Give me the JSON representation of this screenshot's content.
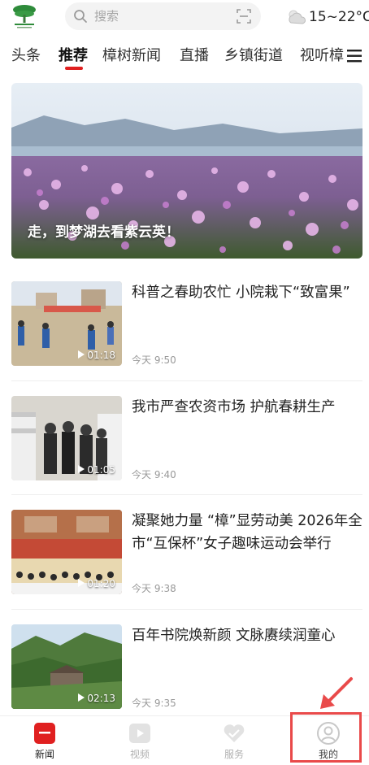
{
  "header": {
    "logo_icon": "zhangshu-logo-icon",
    "search": {
      "placeholder": "搜索",
      "icon": "search-icon",
      "scan_icon": "scan-icon"
    },
    "weather": {
      "icon": "cloud-sun-icon",
      "text": "15~22°C"
    }
  },
  "tabs": {
    "items": [
      {
        "label": "头条"
      },
      {
        "label": "推荐"
      },
      {
        "label": "樟树新闻"
      },
      {
        "label": "直播"
      },
      {
        "label": "乡镇街道"
      },
      {
        "label": "视听樟"
      }
    ],
    "active_index": 1,
    "menu_icon": "menu-icon",
    "accent": "#e02020"
  },
  "hero": {
    "caption": "走，到梦湖去看紫云英！"
  },
  "news": [
    {
      "title": "科普之春助农忙 小院栽下“致富果”",
      "duration": "01:18",
      "time": "今天 9:50"
    },
    {
      "title": "我市严查农资市场 护航春耕生产",
      "duration": "01:05",
      "time": "今天 9:40"
    },
    {
      "title": "凝聚她力量 “樟”显劳动美 2026年全市“互保杯”女子趣味运动会举行",
      "duration": "01:20",
      "time": "今天 9:38"
    },
    {
      "title": "百年书院焕新颜 文脉赓续润童心",
      "duration": "02:13",
      "time": "今天 9:35"
    }
  ],
  "bottom_nav": {
    "items": [
      {
        "label": "新闻",
        "icon": "news-icon",
        "active": true
      },
      {
        "label": "视频",
        "icon": "video-icon",
        "active": false
      },
      {
        "label": "服务",
        "icon": "service-heart-icon",
        "active": false
      },
      {
        "label": "我的",
        "icon": "profile-icon",
        "active": false
      }
    ]
  },
  "annotation": {
    "color": "#e94a4a"
  }
}
